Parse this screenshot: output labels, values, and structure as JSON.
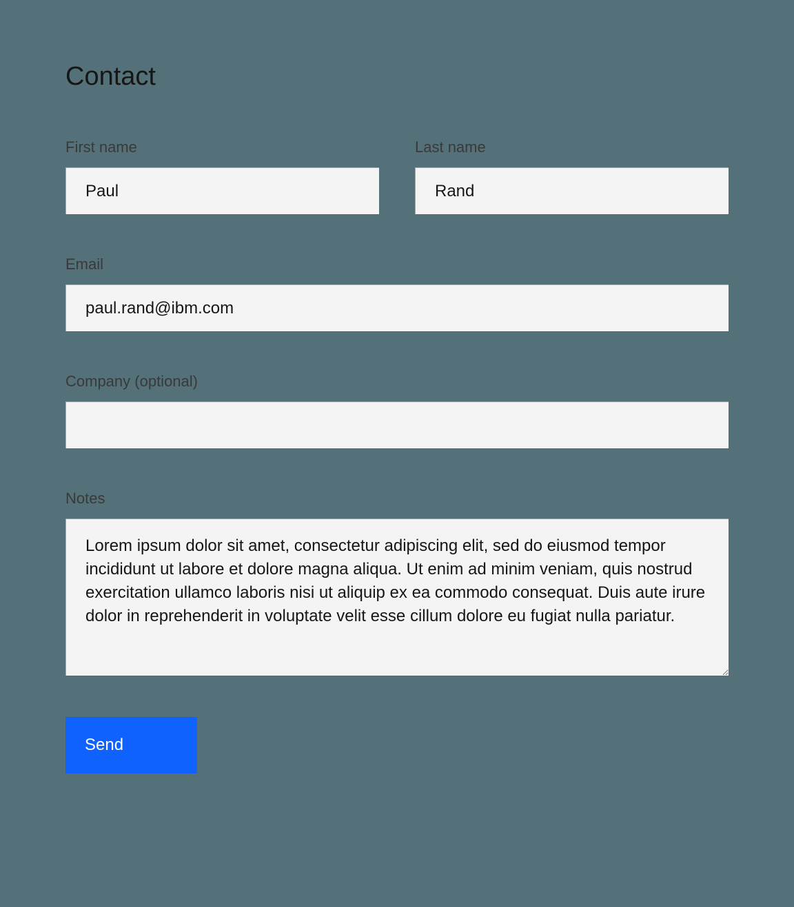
{
  "form": {
    "title": "Contact",
    "fields": {
      "firstName": {
        "label": "First name",
        "value": "Paul"
      },
      "lastName": {
        "label": "Last name",
        "value": "Rand"
      },
      "email": {
        "label": "Email",
        "value": "paul.rand@ibm.com"
      },
      "company": {
        "label": "Company (optional)",
        "value": ""
      },
      "notes": {
        "label": "Notes",
        "value": "Lorem ipsum dolor sit amet, consectetur adipiscing elit, sed do eiusmod tempor incididunt ut labore et dolore magna aliqua. Ut enim ad minim veniam, quis nostrud exercitation ullamco laboris nisi ut aliquip ex ea commodo consequat. Duis aute irure dolor in reprehenderit in voluptate velit esse cillum dolore eu fugiat nulla pariatur."
      }
    },
    "submit": {
      "label": "Send"
    }
  }
}
